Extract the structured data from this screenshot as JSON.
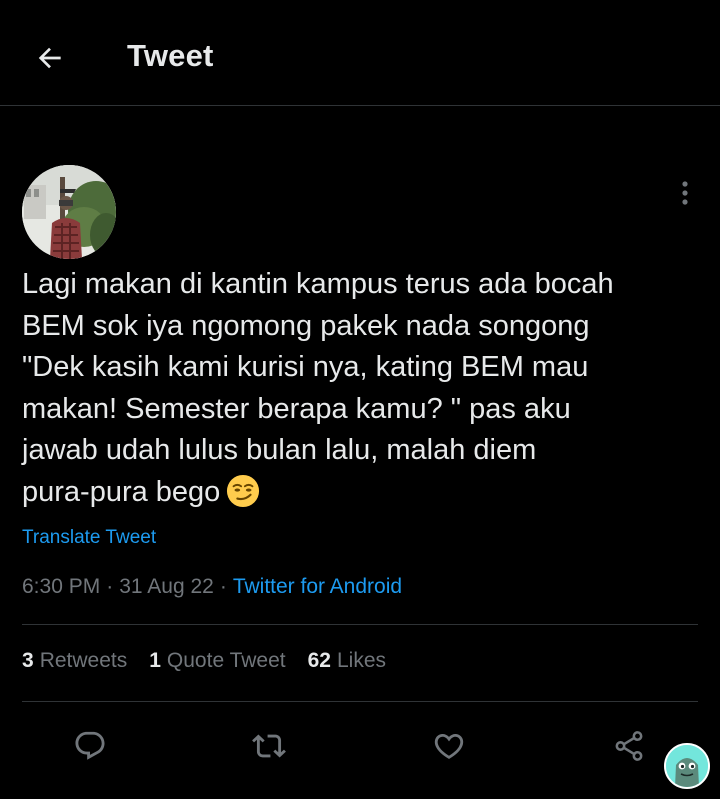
{
  "header": {
    "title": "Tweet"
  },
  "tweet": {
    "text": "Lagi makan di kantin kampus terus ada bocah\nBEM sok iya ngomong pakek nada songong\n\"Dek kasih kami kurisi nya, kating BEM mau\nmakan! Semester berapa kamu? \" pas aku\njawab udah lulus bulan lalu, malah diem\npura-pura bego",
    "emoji": "smirking-face",
    "translate_label": "Translate Tweet",
    "time": "6:30 PM",
    "date": "31 Aug 22",
    "separator": "·",
    "source": "Twitter for Android"
  },
  "stats": {
    "retweets_count": "3",
    "retweets_label": "Retweets",
    "quotes_count": "1",
    "quotes_label": "Quote Tweet",
    "likes_count": "62",
    "likes_label": "Likes"
  },
  "actions": [
    "reply-icon",
    "retweet-icon",
    "like-icon",
    "share-icon"
  ],
  "colors": {
    "background": "#000000",
    "text": "#e7e9ea",
    "secondary": "#71767b",
    "link": "#1d9bf0",
    "border": "#2f3336",
    "bubble": "#73e6dc"
  }
}
